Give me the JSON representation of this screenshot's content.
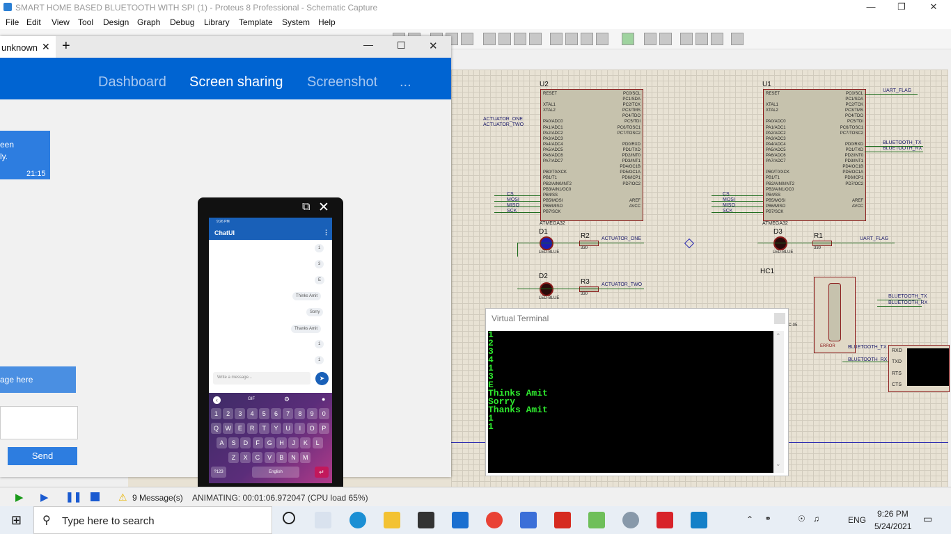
{
  "app": {
    "title": "SMART HOME BASED BLUETOOTH WITH SPI (1) - Proteus 8 Professional - Schematic Capture",
    "menus": [
      "File",
      "Edit",
      "View",
      "Tool",
      "Design",
      "Graph",
      "Debug",
      "Library",
      "Template",
      "System",
      "Help"
    ]
  },
  "share": {
    "tab_label": "unknown",
    "nav": [
      "Dashboard",
      "Screen sharing",
      "Screenshot",
      "..."
    ],
    "bubble_text_1": "een",
    "bubble_text_2": "ly.",
    "bubble_time": "21:15",
    "input_hint": "age here",
    "send_label": "Send"
  },
  "phone": {
    "status_time": "9:26 PM",
    "app_title": "ChatUI",
    "messages": [
      "1",
      "3",
      "E",
      "Thinks Amit",
      "Sorry",
      "Thanks Amit",
      "1",
      "1"
    ],
    "input_placeholder": "Write a message...",
    "kb_top": [
      "GIF"
    ],
    "kb_row1": [
      "1",
      "2",
      "3",
      "4",
      "5",
      "6",
      "7",
      "8",
      "9",
      "0"
    ],
    "kb_row2": [
      "Q",
      "W",
      "E",
      "R",
      "T",
      "Y",
      "U",
      "I",
      "O",
      "P"
    ],
    "kb_row3": [
      "A",
      "S",
      "D",
      "F",
      "G",
      "H",
      "J",
      "K",
      "L"
    ],
    "kb_row4": [
      "Z",
      "X",
      "C",
      "V",
      "B",
      "N",
      "M"
    ],
    "kb_sym": "?123",
    "kb_space": "English"
  },
  "schematic": {
    "u2": {
      "ref": "U2",
      "part": "ATMEGA32",
      "left_pins": "RESET\n\nXTAL1\nXTAL2\n\nPA0/ADC0\nPA1/ADC1\nPA2/ADC2\nPA3/ADC3\nPA4/ADC4\nPA5/ADC5\nPA6/ADC6\nPA7/ADC7\n\nPB0/T0/XCK\nPB1/T1\nPB2/AIN0/INT2\nPB3/AIN1/OC0\nPB4/SS\nPB5/MOSI\nPB6/MISO\nPB7/SCK",
      "right_pins": "PC0/SCL\nPC1/SDA\nPC2/TCK\nPC3/TMS\nPC4/TDO\nPC5/TDI\nPC6/TOSC1\nPC7/TOSC2\n\nPD0/RXD\nPD1/TXD\nPD2/INT0\nPD3/INT1\nPD4/OC1B\nPD5/OC1A\nPD6/ICP1\nPD7/OC2\n\n\nAREF\nAVCC"
    },
    "u1": {
      "ref": "U1",
      "part": "ATMEGA32"
    },
    "net_labels": {
      "act_one": "ACTUATOR_ONE",
      "act_two": "ACTUATOR_TWO",
      "cs": "CS",
      "mosi": "MOSI",
      "miso": "MISO",
      "sck": "SCK",
      "uart_flag": "UART_FLAG",
      "bt_tx": "BLUETOOTH_TX",
      "bt_rx": "BLUETOOTH_RX"
    },
    "d1": {
      "ref": "D1",
      "part": "LED-BLUE"
    },
    "d2": {
      "ref": "D2",
      "part": "LED-BLUE"
    },
    "d3": {
      "ref": "D3",
      "part": "LED-BLUE"
    },
    "r1": {
      "ref": "R1",
      "value": "330"
    },
    "r2": {
      "ref": "R2",
      "value": "330"
    },
    "r3": {
      "ref": "R3",
      "value": "330"
    },
    "hc": {
      "ref": "HC1",
      "part": "HC-05",
      "error": "ERROR"
    },
    "vterm_pins": [
      "RXD",
      "TXD",
      "RTS",
      "CTS"
    ]
  },
  "terminal": {
    "title": "Virtual Terminal",
    "lines": [
      "1",
      "2",
      "3",
      "4",
      "1",
      "3",
      "E",
      "Thinks Amit",
      "Sorry",
      "Thanks Amit",
      "1",
      "1"
    ]
  },
  "status": {
    "messages": "9 Message(s)",
    "animating": "ANIMATING: 00:01:06.972047 (CPU load 65%)"
  },
  "taskbar": {
    "search_placeholder": "Type here to search",
    "lang": "ENG",
    "time": "9:26 PM",
    "date": "5/24/2021"
  },
  "colors": {
    "share_blue": "#0064d2",
    "terminal_green": "#2ee82e",
    "schematic_bg": "#e8e2d4",
    "wire": "#1a6a1a"
  }
}
